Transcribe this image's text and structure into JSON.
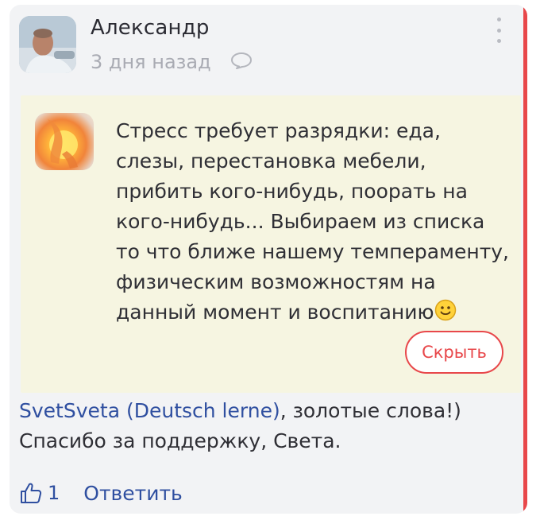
{
  "comment": {
    "author": "Александр",
    "time": "3 дня назад",
    "avatar_icon": "user-photo",
    "comment_icon": "speech-bubble-icon",
    "menu_icon": "vertical-dots-icon"
  },
  "quote": {
    "avatar_icon": "user-photo-sunset",
    "text": "Стресс требует разрядки: еда, слезы, перестановка мебели, прибить кого-нибудь, поорать на кого-нибудь... Выбираем из списка то что ближе нашему темпераменту, физическим возможностям на данный момент и воспитанию",
    "emoji_icon": "smiley-icon",
    "hide_label": "Скрыть"
  },
  "reply": {
    "mention": "SvetSveta (Deutsch lerne)",
    "text_after_mention": ", золотые слова!) Спасибо за поддержку, Света."
  },
  "actions": {
    "like_icon": "thumbs-up-icon",
    "like_count": "1",
    "reply_label": "Ответить"
  },
  "colors": {
    "accent": "#e8474a",
    "link": "#2f4fa0",
    "card_bg": "#f2f3f5",
    "quote_bg": "#f6f5e1"
  }
}
